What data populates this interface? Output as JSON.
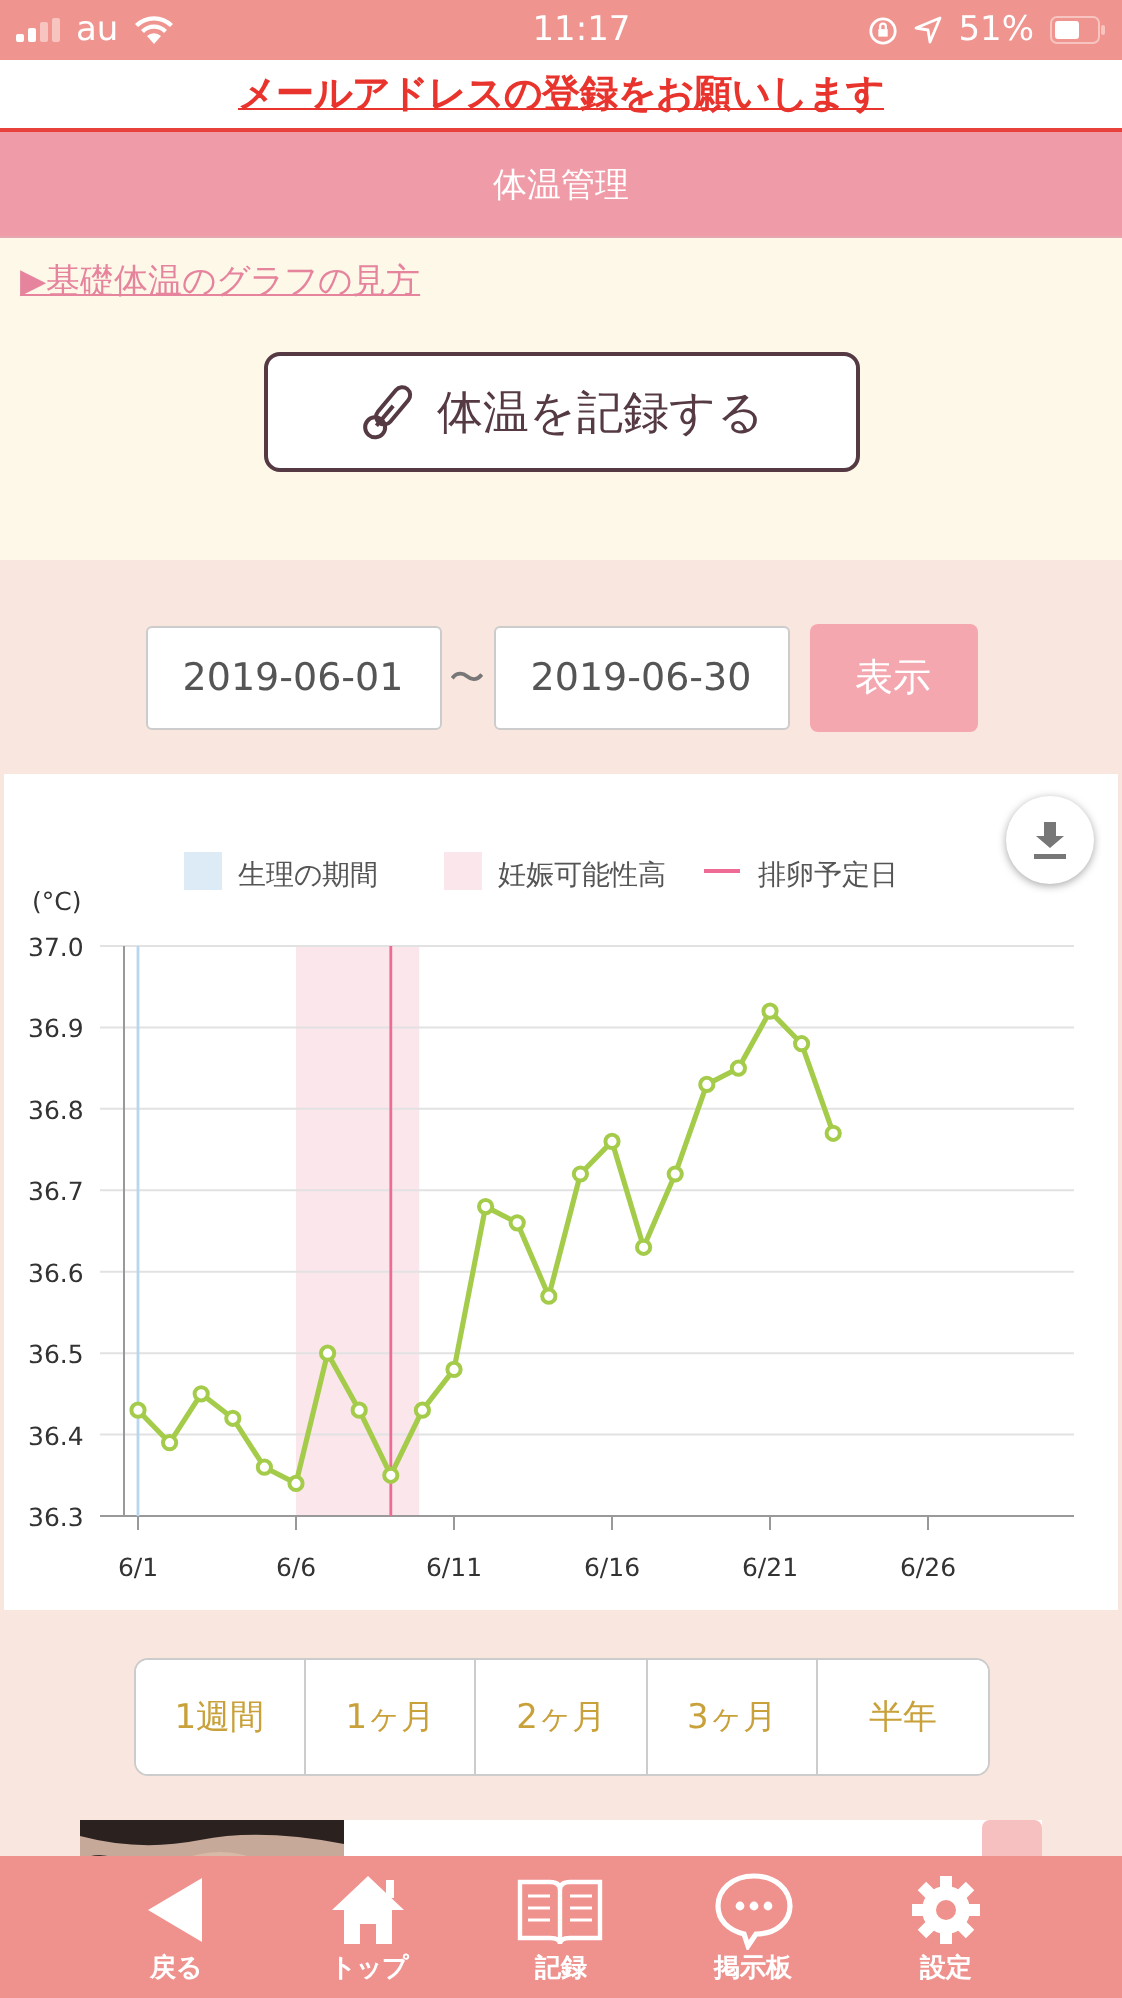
{
  "status_bar": {
    "carrier": "au",
    "time": "11:17",
    "battery": "51%"
  },
  "notice": "メールアドレスの登録をお願いします",
  "header": {
    "title": "体温管理"
  },
  "guide_link": "▶基礎体温のグラフの見方",
  "record_button": "体温を記録する",
  "date_range": {
    "from": "2019-06-01",
    "separator": "〜",
    "to": "2019-06-30",
    "button": "表示"
  },
  "legend": [
    {
      "label": "生理の期間",
      "color": "#dcebf5",
      "kind": "band"
    },
    {
      "label": "妊娠可能性高",
      "color": "#fbe6ec",
      "kind": "band"
    },
    {
      "label": "排卵予定日",
      "color": "#ee6b95",
      "kind": "line"
    }
  ],
  "chart_data": {
    "type": "line",
    "ylabel": "(°C)",
    "categories": [
      "6/1",
      null,
      null,
      null,
      null,
      "6/6",
      null,
      null,
      null,
      null,
      "6/11",
      null,
      null,
      null,
      null,
      "6/16",
      null,
      null,
      null,
      null,
      "6/21",
      null,
      null,
      null,
      null,
      "6/26",
      null,
      null,
      null,
      null
    ],
    "series": [
      {
        "color": "#a4cc4a",
        "marker": "circle",
        "values": [
          36.43,
          36.39,
          36.45,
          36.42,
          36.36,
          36.34,
          36.5,
          36.43,
          36.35,
          36.43,
          36.48,
          36.68,
          36.66,
          36.57,
          36.72,
          36.76,
          36.63,
          36.72,
          36.83,
          36.85,
          36.92,
          36.88,
          36.77,
          null,
          null,
          null,
          null,
          null,
          null,
          null
        ]
      }
    ],
    "ylim": [
      36.3,
      37.0
    ],
    "yticks": [
      {
        "value": 37.0,
        "label": "37.0"
      },
      {
        "value": 36.9,
        "label": "36.9"
      },
      {
        "value": 36.8,
        "label": "36.8"
      },
      {
        "value": 36.7,
        "label": "36.7"
      },
      {
        "value": 36.6,
        "label": "36.6"
      },
      {
        "value": 36.5,
        "label": "36.5"
      },
      {
        "value": 36.4,
        "label": "36.4"
      },
      {
        "value": 36.3,
        "label": "36.3"
      }
    ],
    "grid": true
  },
  "ranges": [
    {
      "label": "1週間"
    },
    {
      "label": "1ヶ月"
    },
    {
      "label": "2ヶ月"
    },
    {
      "label": "3ヶ月"
    },
    {
      "label": "半年"
    }
  ],
  "nav": [
    {
      "label": "戻る",
      "kind": "back"
    },
    {
      "label": "トップ",
      "kind": "home"
    },
    {
      "label": "記録",
      "kind": "book"
    },
    {
      "label": "掲示板",
      "kind": "chat"
    },
    {
      "label": "設定",
      "kind": "gear"
    }
  ]
}
